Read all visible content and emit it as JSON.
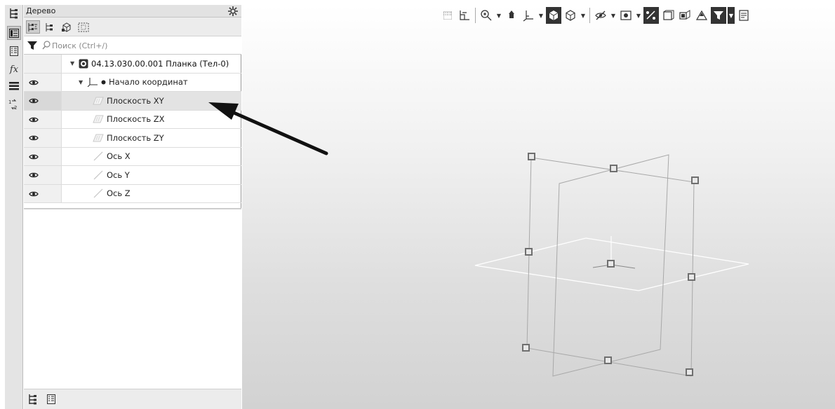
{
  "panel": {
    "title": "Дерево",
    "search_placeholder": "Поиск (Ctrl+/)"
  },
  "left_toolbar": {
    "fx_label": "fx"
  },
  "tree": {
    "rows": [
      {
        "label": "04.13.030.00.001 Планка (Тел-0)",
        "visible": false,
        "selected": false
      },
      {
        "label": "Начало координат",
        "visible": true,
        "selected": false
      },
      {
        "label": "Плоскость XY",
        "visible": true,
        "selected": true
      },
      {
        "label": "Плоскость ZX",
        "visible": true,
        "selected": false
      },
      {
        "label": "Плоскость ZY",
        "visible": true,
        "selected": false
      },
      {
        "label": "Ось X",
        "visible": true,
        "selected": false
      },
      {
        "label": "Ось Y",
        "visible": true,
        "selected": false
      },
      {
        "label": "Ось Z",
        "visible": true,
        "selected": false
      }
    ]
  },
  "icons": {
    "panel_gear": "gear-icon",
    "filter": "filter-icon",
    "search": "search-icon",
    "visibility": "eye-icon",
    "arrow": "pointer-arrow"
  },
  "colors": {
    "panel_bg": "#ffffff",
    "toolbar_bg": "#e4e4e4",
    "selected_row": "#e3e3e3",
    "viewport_top": "#ffffff",
    "viewport_bottom": "#d2d2d2",
    "plane_line": "#a8a8a8",
    "handle": "#7a7a7a"
  }
}
